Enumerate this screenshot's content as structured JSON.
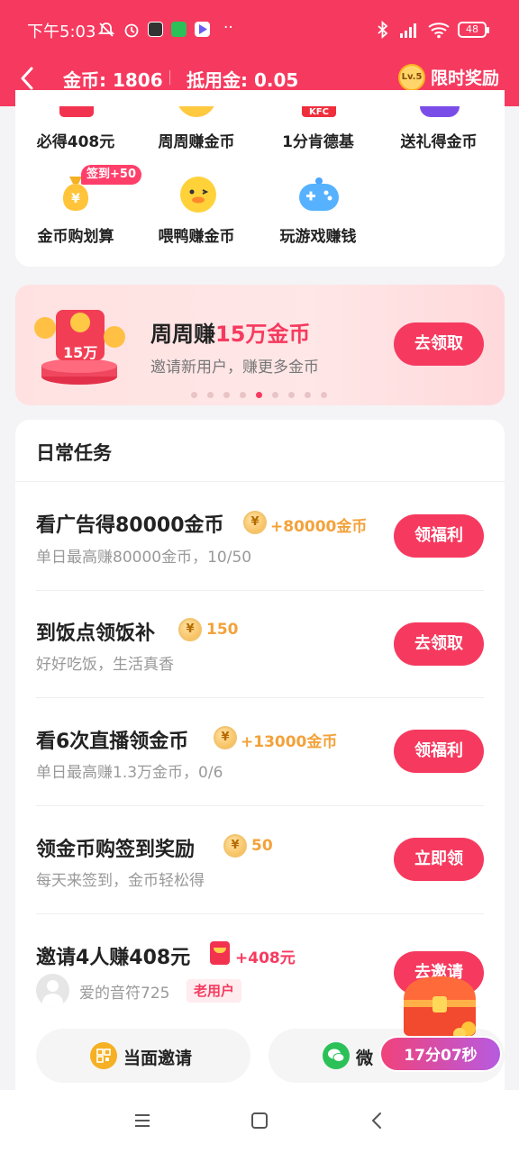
{
  "status": {
    "time": "下午5:03",
    "battery": "48"
  },
  "header": {
    "coins": "金币: 1806",
    "deduct": "抵用金: 0.05",
    "level": "Lv.5",
    "reward": "限时奖励"
  },
  "grid": {
    "items": [
      {
        "label": "必得408元",
        "icon": "red-packet-icon"
      },
      {
        "label": "周周赚金币",
        "icon": "coin-face-icon"
      },
      {
        "label": "1分肯德基",
        "icon": "kfc-icon",
        "icon_text": "KFC"
      },
      {
        "label": "送礼得金币",
        "icon": "gift-icon"
      },
      {
        "label": "金币购划算",
        "icon": "money-bag-icon",
        "badge": "签到+50"
      },
      {
        "label": "喂鸭赚金币",
        "icon": "duck-icon"
      },
      {
        "label": "玩游戏赚钱",
        "icon": "gamepad-icon"
      }
    ]
  },
  "banner": {
    "title_prefix": "周周赚",
    "title_highlight": "15万金币",
    "subtitle": "邀请新用户，赚更多金币",
    "illustration_label": "15万",
    "button": "去领取",
    "dots_count": 9,
    "active_dot": 4
  },
  "tasks": {
    "header": "日常任务",
    "items": [
      {
        "title": "看广告得80000金币",
        "reward": "+80000金币",
        "subtitle": "单日最高赚80000金币，10/50",
        "button": "领福利"
      },
      {
        "title": "到饭点领饭补",
        "reward": "150",
        "subtitle": "好好吃饭，生活真香",
        "button": "去领取"
      },
      {
        "title": "看6次直播领金币",
        "reward": "+13000金币",
        "subtitle": "单日最高赚1.3万金币，0/6",
        "button": "领福利"
      },
      {
        "title": "领金币购签到奖励",
        "reward": "50",
        "subtitle": "每天来签到，金币轻松得",
        "button": "立即领"
      },
      {
        "title": "邀请4人赚408元",
        "reward": "+408元",
        "button": "去邀请"
      }
    ],
    "invitee_name": "爱的音符725",
    "invitee_tag": "老用户",
    "invite_face": "当面邀请",
    "invite_wechat": "微"
  },
  "floating": {
    "timer": "17分07秒"
  },
  "colors": {
    "brand": "#f63a5f",
    "coin_gold": "#f3a23a"
  }
}
